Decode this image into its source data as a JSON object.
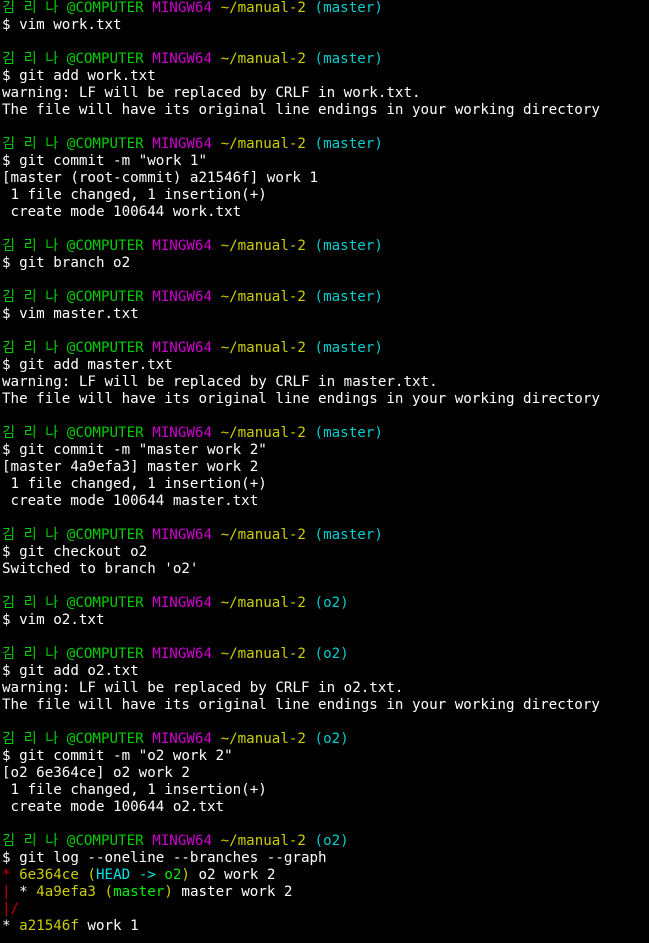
{
  "colors": {
    "background": "#000000",
    "foreground": "#ffffff",
    "user": "#00cd00",
    "shell": "#cd00cd",
    "path": "#cdcd00",
    "branch": "#00cdcd",
    "graph_line": "#cd0000"
  },
  "prompt": {
    "user": "김 리 나 @COMPUTER",
    "shell": "MINGW64",
    "path": "~/manual-2"
  },
  "blocks": [
    {
      "branch": "(master)",
      "command": "$ vim work.txt",
      "output": []
    },
    {
      "branch": "(master)",
      "command": "$ git add work.txt",
      "output": [
        "warning: LF will be replaced by CRLF in work.txt.",
        "The file will have its original line endings in your working directory"
      ]
    },
    {
      "branch": "(master)",
      "command": "$ git commit -m \"work 1\"",
      "output": [
        "[master (root-commit) a21546f] work 1",
        " 1 file changed, 1 insertion(+)",
        " create mode 100644 work.txt"
      ]
    },
    {
      "branch": "(master)",
      "command": "$ git branch o2",
      "output": []
    },
    {
      "branch": "(master)",
      "command": "$ vim master.txt",
      "output": []
    },
    {
      "branch": "(master)",
      "command": "$ git add master.txt",
      "output": [
        "warning: LF will be replaced by CRLF in master.txt.",
        "The file will have its original line endings in your working directory"
      ]
    },
    {
      "branch": "(master)",
      "command": "$ git commit -m \"master work 2\"",
      "output": [
        "[master 4a9efa3] master work 2",
        " 1 file changed, 1 insertion(+)",
        " create mode 100644 master.txt"
      ]
    },
    {
      "branch": "(master)",
      "command": "$ git checkout o2",
      "output": [
        "Switched to branch 'o2'"
      ]
    },
    {
      "branch": "(o2)",
      "command": "$ vim o2.txt",
      "output": []
    },
    {
      "branch": "(o2)",
      "command": "$ git add o2.txt",
      "output": [
        "warning: LF will be replaced by CRLF in o2.txt.",
        "The file will have its original line endings in your working directory"
      ]
    },
    {
      "branch": "(o2)",
      "command": "$ git commit -m \"o2 work 2\"",
      "output": [
        "[o2 6e364ce] o2 work 2",
        " 1 file changed, 1 insertion(+)",
        " create mode 100644 o2.txt"
      ]
    },
    {
      "branch": "(o2)",
      "command": "$ git log --oneline --branches --graph",
      "output": []
    }
  ],
  "log": {
    "line1": {
      "graph": "* ",
      "hash": "6e364ce",
      "open": " (",
      "head": "HEAD -> ",
      "ref": "o2",
      "close": ")",
      "message": " o2 work 2"
    },
    "line2": {
      "graph1": "|",
      "graph2": " * ",
      "hash": "4a9efa3",
      "open": " (",
      "ref": "master",
      "close": ")",
      "message": " master work 2"
    },
    "line3": {
      "graph": "|/"
    },
    "line4": {
      "graph": "* ",
      "hash": "a21546f",
      "message": " work 1"
    }
  }
}
